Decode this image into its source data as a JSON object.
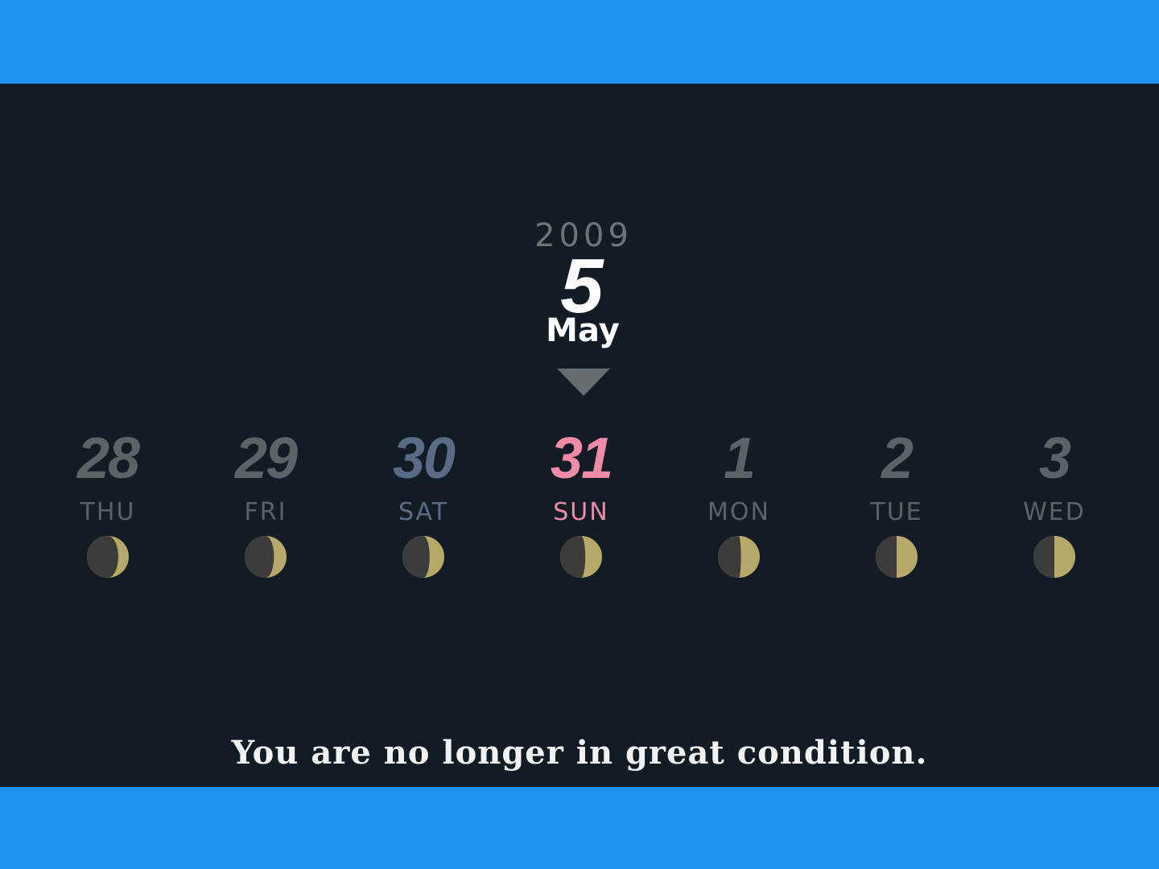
{
  "header": {
    "year": "2009",
    "month_number": "5",
    "month_name": "May"
  },
  "colors": {
    "background": "#121c25",
    "banner": "#2192f0",
    "weekday": "#5c6367",
    "saturday": "#5a6b86",
    "sunday": "#f08aa6",
    "moon_dark": "#3c3c3a",
    "moon_light": "#b9a969"
  },
  "days": [
    {
      "number": "28",
      "weekday": "THU",
      "color": "weekday",
      "moon_icon": "waxing-crescent-icon",
      "lit_fraction": 0.25
    },
    {
      "number": "29",
      "weekday": "FRI",
      "color": "weekday",
      "moon_icon": "waxing-crescent-icon",
      "lit_fraction": 0.3
    },
    {
      "number": "30",
      "weekday": "SAT",
      "color": "saturday",
      "moon_icon": "waxing-crescent-icon",
      "lit_fraction": 0.35
    },
    {
      "number": "31",
      "weekday": "SUN",
      "color": "sunday",
      "moon_icon": "first-quarter-moon-icon",
      "lit_fraction": 0.4
    },
    {
      "number": "1",
      "weekday": "MON",
      "color": "weekday",
      "moon_icon": "first-quarter-moon-icon",
      "lit_fraction": 0.45
    },
    {
      "number": "2",
      "weekday": "TUE",
      "color": "weekday",
      "moon_icon": "first-quarter-moon-icon",
      "lit_fraction": 0.5
    },
    {
      "number": "3",
      "weekday": "WED",
      "color": "weekday",
      "moon_icon": "first-quarter-moon-icon",
      "lit_fraction": 0.5
    }
  ],
  "message": "You are no longer in great condition."
}
